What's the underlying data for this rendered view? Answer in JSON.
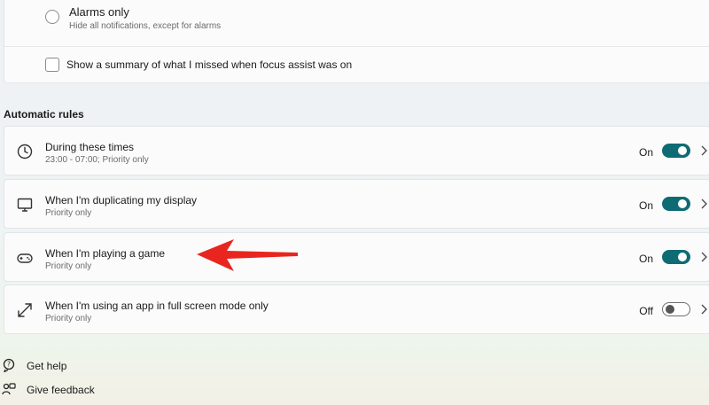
{
  "focus_options": {
    "alarms_only": {
      "label": "Alarms only",
      "description": "Hide all notifications, except for alarms"
    },
    "summary": {
      "label": "Show a summary of what I missed when focus assist was on"
    }
  },
  "automatic_rules": {
    "title": "Automatic rules",
    "rules": [
      {
        "icon": "clock-icon",
        "title": "During these times",
        "subtitle": "23:00 - 07:00; Priority only",
        "state": "On"
      },
      {
        "icon": "monitor-icon",
        "title": "When I'm duplicating my display",
        "subtitle": "Priority only",
        "state": "On"
      },
      {
        "icon": "gamepad-icon",
        "title": "When I'm playing a game",
        "subtitle": "Priority only",
        "state": "On"
      },
      {
        "icon": "fullscreen-icon",
        "title": "When I'm using an app in full screen mode only",
        "subtitle": "Priority only",
        "state": "Off"
      }
    ]
  },
  "footer": {
    "get_help": "Get help",
    "give_feedback": "Give feedback"
  },
  "colors": {
    "toggle_on": "#0f6b73",
    "annotation_arrow": "#e8261f"
  }
}
